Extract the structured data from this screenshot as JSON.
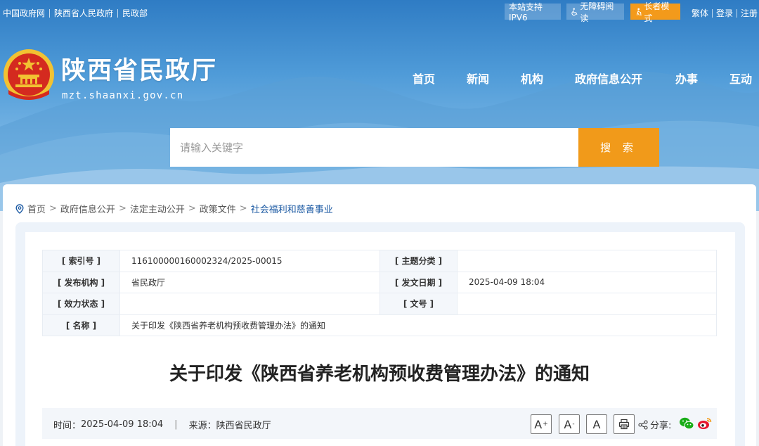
{
  "topbar": {
    "links": [
      "中国政府网",
      "陕西省人民政府",
      "民政部"
    ],
    "ipv6": "本站支持IPV6",
    "accessibility": "无障碍阅读",
    "elder_mode": "长者模式",
    "user_links": [
      "繁体",
      "登录",
      "注册"
    ]
  },
  "site": {
    "title": "陕西省民政厅",
    "domain": "mzt.shaanxi.gov.cn"
  },
  "nav": [
    "首页",
    "新闻",
    "机构",
    "政府信息公开",
    "办事",
    "互动"
  ],
  "search": {
    "placeholder": "请输入关键字",
    "button": "搜 索"
  },
  "breadcrumb": [
    "首页",
    "政府信息公开",
    "法定主动公开",
    "政策文件",
    "社会福利和慈善事业"
  ],
  "meta": {
    "index_label": "[ 索引号 ]",
    "index_value": "116100000160002324/2025-00015",
    "topic_label": "[ 主题分类 ]",
    "topic_value": "",
    "publisher_label": "[ 发布机构 ]",
    "publisher_value": "省民政厅",
    "date_label": "[ 发文日期 ]",
    "date_value": "2025-04-09 18:04",
    "status_label": "[ 效力状态 ]",
    "status_value": "",
    "docno_label": "[ 文号 ]",
    "docno_value": "",
    "name_label": "[ 名称 ]",
    "name_value": "关于印发《陕西省养老机构预收费管理办法》的通知"
  },
  "document": {
    "title": "关于印发《陕西省养老机构预收费管理办法》的通知",
    "time_label": "时间：",
    "time_value": "2025-04-09 18:04",
    "separator": "|",
    "source_label": "来源：",
    "source_value": "陕西省民政厅",
    "share_label": "分享:"
  },
  "font_buttons": {
    "larger": "A",
    "smaller": "A",
    "normal": "A",
    "larger_mark": "+",
    "smaller_mark": "-"
  },
  "colors": {
    "accent_orange": "#f19a1a",
    "link_blue": "#1c5aa3",
    "emblem_red": "#d42a1f",
    "emblem_gold": "#f2c232"
  }
}
